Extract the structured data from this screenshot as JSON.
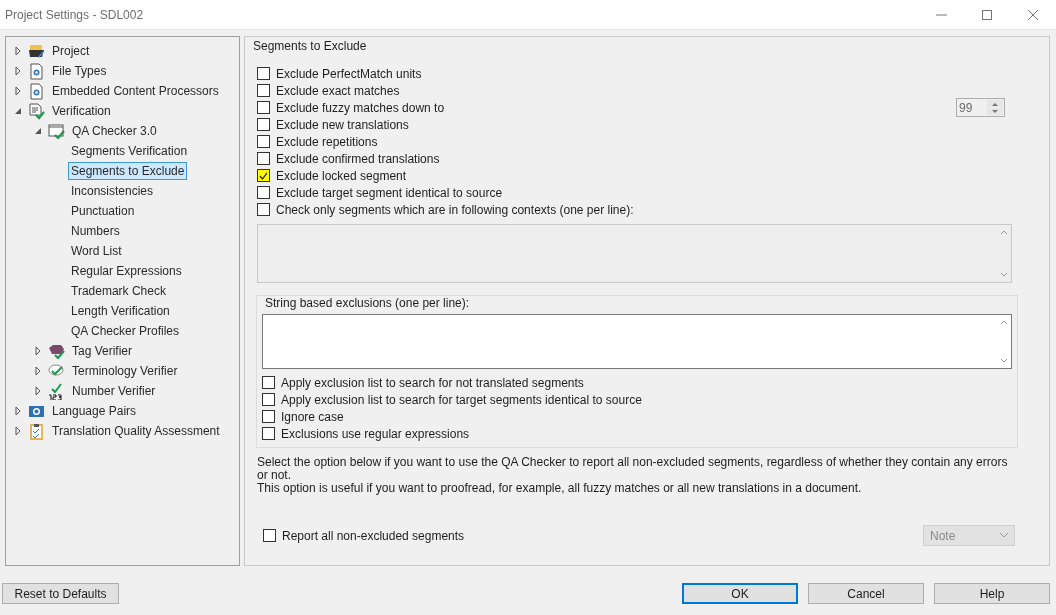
{
  "window": {
    "title": "Project Settings - SDL002"
  },
  "tree": [
    {
      "label": "Project",
      "kind": "project",
      "expanded": false,
      "selected": false
    },
    {
      "label": "File Types",
      "kind": "gear-doc",
      "expanded": false,
      "selected": false
    },
    {
      "label": "Embedded Content Processors",
      "kind": "gear-doc",
      "expanded": false,
      "selected": false
    },
    {
      "label": "Verification",
      "kind": "check-doc",
      "expanded": true,
      "selected": false,
      "children": [
        {
          "label": "QA Checker 3.0",
          "kind": "check-window",
          "expanded": true,
          "selected": false,
          "children": [
            {
              "label": "Segments Verification",
              "selected": false
            },
            {
              "label": "Segments to Exclude",
              "selected": true
            },
            {
              "label": "Inconsistencies",
              "selected": false
            },
            {
              "label": "Punctuation",
              "selected": false
            },
            {
              "label": "Numbers",
              "selected": false
            },
            {
              "label": "Word List",
              "selected": false
            },
            {
              "label": "Regular Expressions",
              "selected": false
            },
            {
              "label": "Trademark Check",
              "selected": false
            },
            {
              "label": "Length Verification",
              "selected": false
            },
            {
              "label": "QA Checker Profiles",
              "selected": false
            }
          ]
        },
        {
          "label": "Tag Verifier",
          "kind": "tag",
          "expanded": false,
          "selected": false
        },
        {
          "label": "Terminology Verifier",
          "kind": "bubble",
          "expanded": false,
          "selected": false
        },
        {
          "label": "Number Verifier",
          "kind": "number",
          "expanded": false,
          "selected": false
        }
      ]
    },
    {
      "label": "Language Pairs",
      "kind": "globe",
      "expanded": false,
      "selected": false
    },
    {
      "label": "Translation Quality Assessment",
      "kind": "clipboard",
      "expanded": false,
      "selected": false
    }
  ],
  "section": {
    "title": "Segments to Exclude",
    "options": [
      {
        "kind": "check",
        "label": "Exclude PerfectMatch units",
        "checked": false,
        "highlighted": false
      },
      {
        "kind": "check",
        "label": "Exclude exact matches",
        "checked": false,
        "highlighted": false
      },
      {
        "kind": "spinner",
        "label": "Exclude fuzzy matches down to",
        "checked": false,
        "highlighted": false,
        "spinner": {
          "value": "99",
          "disabled": true
        }
      },
      {
        "kind": "check",
        "label": "Exclude new translations",
        "checked": false,
        "highlighted": false
      },
      {
        "kind": "check",
        "label": "Exclude repetitions",
        "checked": false,
        "highlighted": false
      },
      {
        "kind": "check",
        "label": "Exclude confirmed translations",
        "checked": false,
        "highlighted": false
      },
      {
        "kind": "check",
        "label": "Exclude locked segment",
        "checked": true,
        "highlighted": true
      },
      {
        "kind": "check",
        "label": "Exclude target segment identical to source",
        "checked": false,
        "highlighted": false
      },
      {
        "kind": "check",
        "label": "Check only segments which are in following contexts (one per line):",
        "checked": false,
        "highlighted": false
      }
    ],
    "contexts_box": {
      "disabled": true
    }
  },
  "string_exclusions": {
    "title": "String based exclusions (one per line):",
    "options": [
      {
        "label": "Apply exclusion list to search for not translated segments",
        "checked": false
      },
      {
        "label": "Apply exclusion list to search for target segments identical to source",
        "checked": false
      },
      {
        "label": "Ignore case",
        "checked": false
      },
      {
        "label": "Exclusions use regular expressions",
        "checked": false
      }
    ]
  },
  "description": [
    "Select the option below if you want to use the QA Checker to report all non-excluded segments, regardless of whether they contain any errors or not.",
    "This option is useful if you want to proofread, for example, all fuzzy matches or all new translations in a document."
  ],
  "report_option": {
    "label": "Report all non-excluded segments",
    "checked": false
  },
  "severity_dropdown": {
    "value": "Note",
    "disabled": true
  },
  "reset_button": {
    "label": "Reset to Defaults"
  },
  "buttons": [
    {
      "label": "OK",
      "default": true
    },
    {
      "label": "Cancel",
      "default": false
    },
    {
      "label": "Help",
      "default": false
    }
  ]
}
